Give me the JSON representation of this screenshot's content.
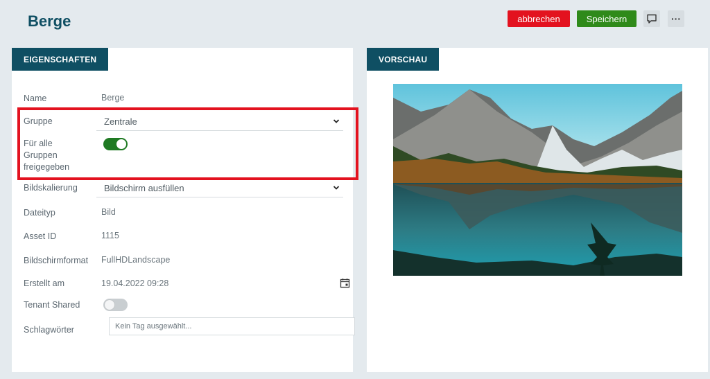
{
  "header": {
    "title": "Berge",
    "cancel_label": "abbrechen",
    "save_label": "Speichern",
    "comment_icon": "chat-bubble-icon",
    "more_label": "···"
  },
  "properties": {
    "tab_label": "EIGENSCHAFTEN",
    "name": {
      "label": "Name",
      "value": "Berge"
    },
    "gruppe": {
      "label": "Gruppe",
      "value": "Zentrale"
    },
    "share_all": {
      "label_line1": "Für alle",
      "label_line2": "Gruppen",
      "label_line3": "freigegeben",
      "enabled": true
    },
    "scaling": {
      "label": "Bildskalierung",
      "value": "Bildschirm ausfüllen"
    },
    "filetype": {
      "label": "Dateityp",
      "value": "Bild"
    },
    "asset_id": {
      "label": "Asset ID",
      "value": "1115"
    },
    "format": {
      "label": "Bildschirmformat",
      "value": "FullHDLandscape"
    },
    "created": {
      "label": "Erstellt am",
      "value": "19.04.2022 09:28"
    },
    "tenant_shared": {
      "label": "Tenant Shared",
      "enabled": false
    },
    "tags": {
      "label": "Schlagwörter",
      "placeholder": "Kein Tag ausgewählt..."
    }
  },
  "preview": {
    "tab_label": "VORSCHAU",
    "image": "mountain-lake-reflection"
  },
  "colors": {
    "brand": "#0f4f63",
    "cancel": "#e3121f",
    "save": "#2f8a1a",
    "toggle_on": "#1f7a23",
    "highlight": "#e3121f"
  }
}
